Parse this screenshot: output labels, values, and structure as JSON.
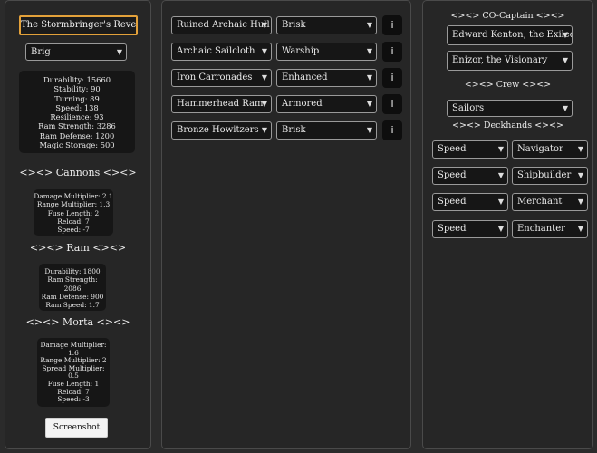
{
  "ship": {
    "name": "The Stormbringer's Revenge",
    "class": "Brig",
    "stats": [
      "Durability: 15660",
      "Stability: 90",
      "Turning: 89",
      "Speed: 138",
      "Resilience: 93",
      "Ram Strength: 3286",
      "Ram Defense: 1200",
      "Magic Storage: 500"
    ]
  },
  "cannons": {
    "heading": "<><> Cannons <><>",
    "stats": [
      "Damage Multiplier: 2.1",
      "Range Multiplier: 1.3",
      "Fuse Length: 2",
      "Reload: 7",
      "Speed: -7"
    ]
  },
  "ram": {
    "heading": "<><> Ram <><>",
    "stats": [
      "Durability: 1800",
      "Ram Strength:",
      "2086",
      "Ram Defense: 900",
      "Ram Speed: 1.7"
    ]
  },
  "morta": {
    "heading": "<><> Morta <><>",
    "stats": [
      "Damage Multiplier:",
      "1.6",
      "Range Multiplier: 2",
      "Spread Multiplier:",
      "0.5",
      "Fuse Length: 1",
      "Reload: 7",
      "Speed: -3"
    ]
  },
  "screenshot_label": "Screenshot",
  "parts": [
    {
      "part": "Ruined Archaic Hull",
      "modifier": "Brisk",
      "info": "i"
    },
    {
      "part": "Archaic Sailcloth",
      "modifier": "Warship",
      "info": "i"
    },
    {
      "part": "Iron Carronades",
      "modifier": "Enhanced",
      "info": "i"
    },
    {
      "part": "Hammerhead Ram",
      "modifier": "Armored",
      "info": "i"
    },
    {
      "part": "Bronze Howitzers",
      "modifier": "Brisk",
      "info": "i"
    }
  ],
  "crew_panel": {
    "cocaptain_heading": "<><> CO-Captain <><>",
    "cocaptain_1": "Edward Kenton, the Exiled C",
    "cocaptain_2": "Enizor, the Visionary",
    "crew_heading": "<><> Crew <><>",
    "crew": "Sailors",
    "deckhands_heading": "<><> Deckhands <><>",
    "deckhands": [
      {
        "stat": "Speed",
        "role": "Navigator"
      },
      {
        "stat": "Speed",
        "role": "Shipbuilder"
      },
      {
        "stat": "Speed",
        "role": "Merchant"
      },
      {
        "stat": "Speed",
        "role": "Enchanter"
      }
    ]
  },
  "icons": {
    "dropdown": "chevron-down-icon",
    "info": "info-icon"
  }
}
